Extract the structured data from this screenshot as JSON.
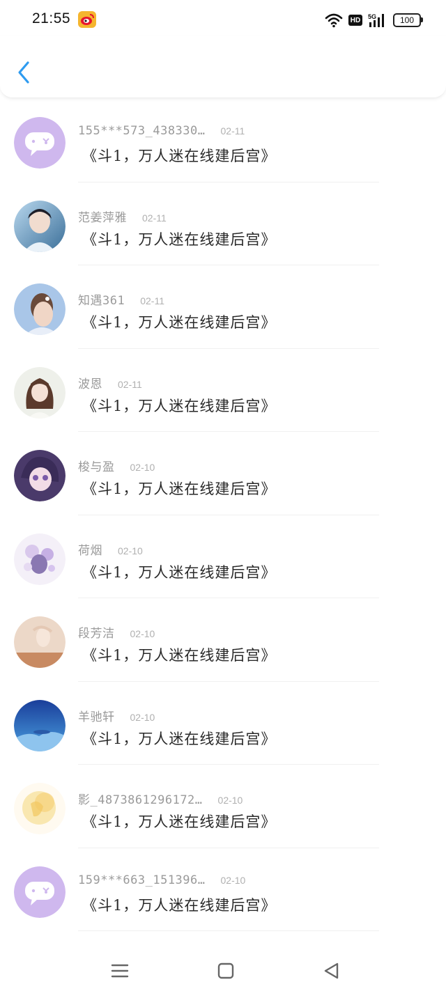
{
  "status_bar": {
    "time": "21:55",
    "icons": [
      "weibo-icon",
      "wifi-icon",
      "hd-icon",
      "signal-5g-icon",
      "battery-icon"
    ],
    "hd": "HD",
    "network": "5G",
    "battery": "100"
  },
  "header": {
    "back_icon": "chevron-left-icon",
    "accent_color": "#2e9bf0"
  },
  "messages": [
    {
      "user": "155***573_438330…",
      "time": "02-11",
      "text": "《斗1，万人迷在线建后宫》",
      "avatar": "chat-bubble-default"
    },
    {
      "user": "范姜萍雅",
      "time": "02-11",
      "text": "《斗1，万人迷在线建后宫》",
      "avatar": "photo"
    },
    {
      "user": "知遇361",
      "time": "02-11",
      "text": "《斗1，万人迷在线建后宫》",
      "avatar": "photo"
    },
    {
      "user": "波恩",
      "time": "02-11",
      "text": "《斗1，万人迷在线建后宫》",
      "avatar": "photo"
    },
    {
      "user": "梭与盈",
      "time": "02-10",
      "text": "《斗1，万人迷在线建后宫》",
      "avatar": "photo"
    },
    {
      "user": "荷烟",
      "time": "02-10",
      "text": "《斗1，万人迷在线建后宫》",
      "avatar": "photo"
    },
    {
      "user": "段芳洁",
      "time": "02-10",
      "text": "《斗1，万人迷在线建后宫》",
      "avatar": "photo"
    },
    {
      "user": "羊驰轩",
      "time": "02-10",
      "text": "《斗1，万人迷在线建后宫》",
      "avatar": "photo"
    },
    {
      "user": "影_4873861296172…",
      "time": "02-10",
      "text": "《斗1，万人迷在线建后宫》",
      "avatar": "photo"
    },
    {
      "user": "159***663_151396…",
      "time": "02-10",
      "text": "《斗1，万人迷在线建后宫》",
      "avatar": "chat-bubble-default"
    }
  ],
  "nav_bar": {
    "buttons": [
      "menu-icon",
      "home-square-icon",
      "back-triangle-icon"
    ]
  }
}
